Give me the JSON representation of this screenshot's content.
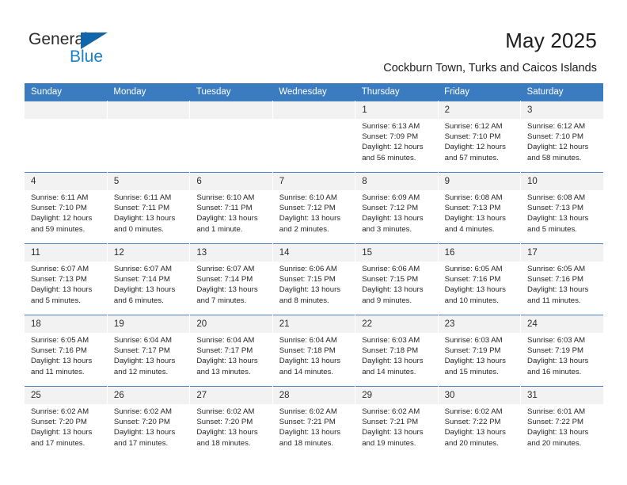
{
  "brand": {
    "line1": "General",
    "line2": "Blue",
    "flag_icon": "blue-triangle-flag-icon"
  },
  "header": {
    "month_title": "May 2025",
    "location": "Cockburn Town, Turks and Caicos Islands"
  },
  "colors": {
    "header_blue": "#3b7cc0",
    "brand_blue": "#1b7fcb",
    "flag_blue": "#1265a8",
    "daynum_band": "#f2f2f2",
    "row_separator": "#4a82c3",
    "text": "#262626"
  },
  "calendar": {
    "weekday_headers": [
      "Sunday",
      "Monday",
      "Tuesday",
      "Wednesday",
      "Thursday",
      "Friday",
      "Saturday"
    ],
    "weeks": [
      [
        {
          "day": "",
          "lines": []
        },
        {
          "day": "",
          "lines": []
        },
        {
          "day": "",
          "lines": []
        },
        {
          "day": "",
          "lines": []
        },
        {
          "day": "1",
          "lines": [
            "Sunrise: 6:13 AM",
            "Sunset: 7:09 PM",
            "Daylight: 12 hours",
            "and 56 minutes."
          ]
        },
        {
          "day": "2",
          "lines": [
            "Sunrise: 6:12 AM",
            "Sunset: 7:10 PM",
            "Daylight: 12 hours",
            "and 57 minutes."
          ]
        },
        {
          "day": "3",
          "lines": [
            "Sunrise: 6:12 AM",
            "Sunset: 7:10 PM",
            "Daylight: 12 hours",
            "and 58 minutes."
          ]
        }
      ],
      [
        {
          "day": "4",
          "lines": [
            "Sunrise: 6:11 AM",
            "Sunset: 7:10 PM",
            "Daylight: 12 hours",
            "and 59 minutes."
          ]
        },
        {
          "day": "5",
          "lines": [
            "Sunrise: 6:11 AM",
            "Sunset: 7:11 PM",
            "Daylight: 13 hours",
            "and 0 minutes."
          ]
        },
        {
          "day": "6",
          "lines": [
            "Sunrise: 6:10 AM",
            "Sunset: 7:11 PM",
            "Daylight: 13 hours",
            "and 1 minute."
          ]
        },
        {
          "day": "7",
          "lines": [
            "Sunrise: 6:10 AM",
            "Sunset: 7:12 PM",
            "Daylight: 13 hours",
            "and 2 minutes."
          ]
        },
        {
          "day": "8",
          "lines": [
            "Sunrise: 6:09 AM",
            "Sunset: 7:12 PM",
            "Daylight: 13 hours",
            "and 3 minutes."
          ]
        },
        {
          "day": "9",
          "lines": [
            "Sunrise: 6:08 AM",
            "Sunset: 7:13 PM",
            "Daylight: 13 hours",
            "and 4 minutes."
          ]
        },
        {
          "day": "10",
          "lines": [
            "Sunrise: 6:08 AM",
            "Sunset: 7:13 PM",
            "Daylight: 13 hours",
            "and 5 minutes."
          ]
        }
      ],
      [
        {
          "day": "11",
          "lines": [
            "Sunrise: 6:07 AM",
            "Sunset: 7:13 PM",
            "Daylight: 13 hours",
            "and 5 minutes."
          ]
        },
        {
          "day": "12",
          "lines": [
            "Sunrise: 6:07 AM",
            "Sunset: 7:14 PM",
            "Daylight: 13 hours",
            "and 6 minutes."
          ]
        },
        {
          "day": "13",
          "lines": [
            "Sunrise: 6:07 AM",
            "Sunset: 7:14 PM",
            "Daylight: 13 hours",
            "and 7 minutes."
          ]
        },
        {
          "day": "14",
          "lines": [
            "Sunrise: 6:06 AM",
            "Sunset: 7:15 PM",
            "Daylight: 13 hours",
            "and 8 minutes."
          ]
        },
        {
          "day": "15",
          "lines": [
            "Sunrise: 6:06 AM",
            "Sunset: 7:15 PM",
            "Daylight: 13 hours",
            "and 9 minutes."
          ]
        },
        {
          "day": "16",
          "lines": [
            "Sunrise: 6:05 AM",
            "Sunset: 7:16 PM",
            "Daylight: 13 hours",
            "and 10 minutes."
          ]
        },
        {
          "day": "17",
          "lines": [
            "Sunrise: 6:05 AM",
            "Sunset: 7:16 PM",
            "Daylight: 13 hours",
            "and 11 minutes."
          ]
        }
      ],
      [
        {
          "day": "18",
          "lines": [
            "Sunrise: 6:05 AM",
            "Sunset: 7:16 PM",
            "Daylight: 13 hours",
            "and 11 minutes."
          ]
        },
        {
          "day": "19",
          "lines": [
            "Sunrise: 6:04 AM",
            "Sunset: 7:17 PM",
            "Daylight: 13 hours",
            "and 12 minutes."
          ]
        },
        {
          "day": "20",
          "lines": [
            "Sunrise: 6:04 AM",
            "Sunset: 7:17 PM",
            "Daylight: 13 hours",
            "and 13 minutes."
          ]
        },
        {
          "day": "21",
          "lines": [
            "Sunrise: 6:04 AM",
            "Sunset: 7:18 PM",
            "Daylight: 13 hours",
            "and 14 minutes."
          ]
        },
        {
          "day": "22",
          "lines": [
            "Sunrise: 6:03 AM",
            "Sunset: 7:18 PM",
            "Daylight: 13 hours",
            "and 14 minutes."
          ]
        },
        {
          "day": "23",
          "lines": [
            "Sunrise: 6:03 AM",
            "Sunset: 7:19 PM",
            "Daylight: 13 hours",
            "and 15 minutes."
          ]
        },
        {
          "day": "24",
          "lines": [
            "Sunrise: 6:03 AM",
            "Sunset: 7:19 PM",
            "Daylight: 13 hours",
            "and 16 minutes."
          ]
        }
      ],
      [
        {
          "day": "25",
          "lines": [
            "Sunrise: 6:02 AM",
            "Sunset: 7:20 PM",
            "Daylight: 13 hours",
            "and 17 minutes."
          ]
        },
        {
          "day": "26",
          "lines": [
            "Sunrise: 6:02 AM",
            "Sunset: 7:20 PM",
            "Daylight: 13 hours",
            "and 17 minutes."
          ]
        },
        {
          "day": "27",
          "lines": [
            "Sunrise: 6:02 AM",
            "Sunset: 7:20 PM",
            "Daylight: 13 hours",
            "and 18 minutes."
          ]
        },
        {
          "day": "28",
          "lines": [
            "Sunrise: 6:02 AM",
            "Sunset: 7:21 PM",
            "Daylight: 13 hours",
            "and 18 minutes."
          ]
        },
        {
          "day": "29",
          "lines": [
            "Sunrise: 6:02 AM",
            "Sunset: 7:21 PM",
            "Daylight: 13 hours",
            "and 19 minutes."
          ]
        },
        {
          "day": "30",
          "lines": [
            "Sunrise: 6:02 AM",
            "Sunset: 7:22 PM",
            "Daylight: 13 hours",
            "and 20 minutes."
          ]
        },
        {
          "day": "31",
          "lines": [
            "Sunrise: 6:01 AM",
            "Sunset: 7:22 PM",
            "Daylight: 13 hours",
            "and 20 minutes."
          ]
        }
      ]
    ]
  }
}
